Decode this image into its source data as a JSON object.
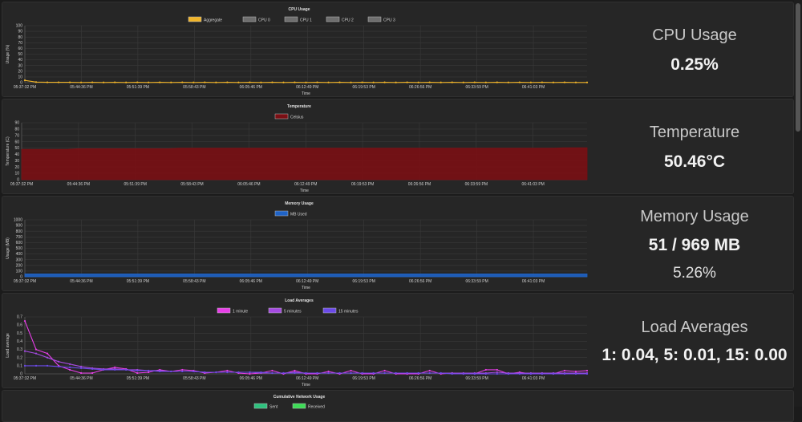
{
  "time_labels": [
    "05:37:32 PM",
    "05:44:36 PM",
    "05:51:39 PM",
    "05:58:43 PM",
    "06:05:46 PM",
    "06:12:49 PM",
    "06:19:53 PM",
    "06:26:56 PM",
    "06:33:59 PM",
    "06:41:03 PM"
  ],
  "cpu": {
    "stat_title": "CPU Usage",
    "stat_value": "0.25%",
    "chart_data": {
      "type": "line",
      "title": "CPU Usage",
      "xlabel": "Time",
      "ylabel": "Usage (%)",
      "ylim": [
        0,
        100
      ],
      "yticks": [
        0,
        10,
        20,
        30,
        40,
        50,
        60,
        70,
        80,
        90,
        100
      ],
      "legend": [
        "Aggregate",
        "CPU 0",
        "CPU 1",
        "CPU 2",
        "CPU 3"
      ],
      "colors": [
        "#f0b429",
        "#6e6e6e",
        "#6e6e6e",
        "#6e6e6e",
        "#6e6e6e"
      ],
      "points": 51,
      "series": [
        {
          "name": "Aggregate",
          "values": [
            4,
            1,
            0.5,
            0.5,
            0.5,
            0.3,
            0.5,
            0.3,
            0.5,
            0.3,
            0.5,
            0.3,
            0.5,
            0.3,
            0.5,
            0.3,
            0.5,
            0.3,
            0.5,
            0.3,
            0.5,
            0.3,
            0.5,
            0.3,
            0.5,
            0.3,
            0.5,
            0.3,
            0.5,
            0.3,
            0.5,
            0.3,
            0.5,
            0.3,
            0.5,
            0.3,
            0.5,
            0.3,
            0.5,
            0.3,
            0.5,
            0.3,
            0.5,
            0.3,
            0.5,
            0.3,
            0.5,
            0.3,
            0.5,
            0.3,
            0.3
          ]
        }
      ]
    }
  },
  "temperature": {
    "stat_title": "Temperature",
    "stat_value": "50.46°C",
    "chart_data": {
      "type": "area",
      "title": "Temperature",
      "xlabel": "Time",
      "ylabel": "Temperature (C)",
      "ylim": [
        0,
        90
      ],
      "yticks": [
        0,
        10,
        20,
        30,
        40,
        50,
        60,
        70,
        80,
        90
      ],
      "legend": [
        "Celsius"
      ],
      "colors": [
        "#7a0f14"
      ],
      "points": 51,
      "series": [
        {
          "name": "Celsius",
          "values": [
            48,
            48,
            48,
            48,
            48,
            49,
            49,
            49,
            49,
            49,
            49,
            49,
            49,
            49,
            50,
            50,
            50,
            50,
            50,
            50,
            50,
            50,
            50,
            50,
            50,
            50,
            50,
            50,
            50,
            50,
            50,
            50,
            50,
            50,
            50,
            50,
            50,
            50,
            50,
            50,
            50,
            50,
            50,
            50,
            50,
            50,
            50,
            50,
            50.5,
            50.5,
            50.5
          ]
        }
      ]
    }
  },
  "memory": {
    "stat_title": "Memory Usage",
    "stat_value": "51 / 969 MB",
    "stat_percent": "5.26%",
    "chart_data": {
      "type": "area",
      "title": "Memory Usage",
      "xlabel": "Time",
      "ylabel": "Usage (MB)",
      "ylim": [
        0,
        1000
      ],
      "yticks": [
        0,
        100,
        200,
        300,
        400,
        500,
        600,
        700,
        800,
        900,
        1000
      ],
      "legend": [
        "MB Used"
      ],
      "colors": [
        "#1f63c6"
      ],
      "points": 51,
      "series": [
        {
          "name": "MB Used",
          "values": [
            51,
            51,
            51,
            51,
            51,
            51,
            51,
            51,
            51,
            51,
            51,
            51,
            51,
            51,
            51,
            51,
            51,
            51,
            51,
            51,
            51,
            51,
            51,
            51,
            51,
            51,
            51,
            51,
            51,
            51,
            51,
            51,
            51,
            51,
            51,
            51,
            51,
            51,
            51,
            51,
            51,
            51,
            51,
            51,
            51,
            51,
            51,
            51,
            51,
            51,
            51
          ]
        }
      ]
    }
  },
  "load": {
    "stat_title": "Load Averages",
    "stat_value": "1: 0.04, 5: 0.01, 15: 0.00",
    "chart_data": {
      "type": "line",
      "title": "Load Averages",
      "xlabel": "Time",
      "ylabel": "Load average",
      "ylim": [
        0,
        0.7
      ],
      "yticks": [
        0,
        0.1,
        0.2,
        0.3,
        0.4,
        0.5,
        0.6,
        0.7
      ],
      "legend": [
        "1 minute",
        "5 minutes",
        "15 minutes"
      ],
      "colors": [
        "#e83ee8",
        "#a44ae0",
        "#6b4ae8"
      ],
      "points": 51,
      "series": [
        {
          "name": "1 minute",
          "values": [
            0.65,
            0.3,
            0.25,
            0.1,
            0.05,
            0.01,
            0.01,
            0.05,
            0.08,
            0.06,
            0.01,
            0.02,
            0.05,
            0.03,
            0.05,
            0.04,
            0.01,
            0.02,
            0.04,
            0.01,
            0.0,
            0.01,
            0.04,
            0.0,
            0.04,
            0.0,
            0.0,
            0.03,
            0.0,
            0.04,
            0.0,
            0.0,
            0.04,
            0.0,
            0.0,
            0.0,
            0.04,
            0.0,
            0.01,
            0.0,
            0.0,
            0.05,
            0.05,
            0.0,
            0.02,
            0.0,
            0.0,
            0.0,
            0.04,
            0.03,
            0.04
          ]
        },
        {
          "name": "5 minutes",
          "values": [
            0.28,
            0.25,
            0.2,
            0.15,
            0.12,
            0.09,
            0.07,
            0.06,
            0.06,
            0.05,
            0.05,
            0.04,
            0.04,
            0.03,
            0.03,
            0.03,
            0.02,
            0.02,
            0.02,
            0.02,
            0.02,
            0.01,
            0.01,
            0.01,
            0.02,
            0.01,
            0.01,
            0.01,
            0.01,
            0.01,
            0.01,
            0.01,
            0.01,
            0.01,
            0.01,
            0.01,
            0.01,
            0.01,
            0.01,
            0.01,
            0.01,
            0.01,
            0.02,
            0.01,
            0.01,
            0.01,
            0.01,
            0.01,
            0.01,
            0.01,
            0.01
          ]
        },
        {
          "name": "15 minutes",
          "values": [
            0.1,
            0.1,
            0.1,
            0.09,
            0.08,
            0.07,
            0.06,
            0.05,
            0.05,
            0.05,
            0.04,
            0.04,
            0.03,
            0.03,
            0.03,
            0.03,
            0.02,
            0.02,
            0.02,
            0.02,
            0.02,
            0.02,
            0.01,
            0.01,
            0.01,
            0.01,
            0.01,
            0.01,
            0.01,
            0.01,
            0.01,
            0.01,
            0.01,
            0.01,
            0.01,
            0.01,
            0.01,
            0.01,
            0.0,
            0.0,
            0.0,
            0.0,
            0.0,
            0.0,
            0.0,
            0.0,
            0.0,
            0.0,
            0.0,
            0.0,
            0.0
          ]
        }
      ]
    }
  },
  "network": {
    "chart_data": {
      "type": "line",
      "title": "Cumulative Network Usage",
      "legend": [
        "Sent",
        "Received"
      ],
      "colors": [
        "#2ec27e",
        "#3ddc56"
      ]
    }
  }
}
